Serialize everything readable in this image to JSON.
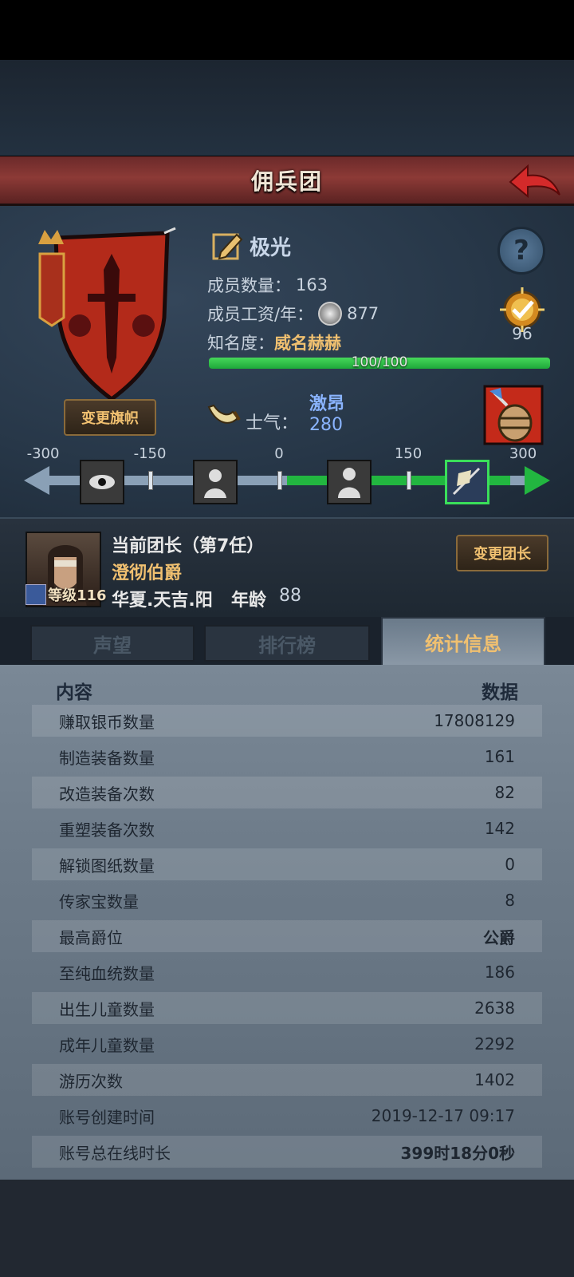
{
  "header": {
    "title": "佣兵团"
  },
  "guild": {
    "name": "极光",
    "members_label": "成员数量：",
    "members": "163",
    "salary_label": "成员工资/年：",
    "salary": "877",
    "fame_label": "知名度：",
    "fame": "威名赫赫",
    "fame_progress_text": "100/100",
    "fame_progress": 1.0,
    "badge_value": "96",
    "change_flag_label": "变更旗帜",
    "morale_label": "士气：",
    "morale_state": "激昂",
    "morale_value": "280"
  },
  "morale_scale": {
    "labels": [
      "-300",
      "-150",
      "0",
      "150",
      "300"
    ],
    "min": -300,
    "max": 300,
    "value": 280
  },
  "leader": {
    "title": "当前团长（第7任）",
    "rank": "澄彻伯爵",
    "level": "等级116",
    "name": "华夏.天吉.阳",
    "age_label": "年龄",
    "age": "88",
    "change_label": "变更团长"
  },
  "tabs": [
    {
      "label": "声望"
    },
    {
      "label": "排行榜"
    },
    {
      "label": "统计信息"
    }
  ],
  "stats": {
    "col_content": "内容",
    "col_data": "数据",
    "rows": [
      {
        "k": "赚取银币数量",
        "v": "17808129"
      },
      {
        "k": "制造装备数量",
        "v": "161"
      },
      {
        "k": "改造装备次数",
        "v": "82"
      },
      {
        "k": "重塑装备次数",
        "v": "142"
      },
      {
        "k": "解锁图纸数量",
        "v": "0"
      },
      {
        "k": "传家宝数量",
        "v": "8"
      },
      {
        "k": "最高爵位",
        "v": "公爵"
      },
      {
        "k": "至纯血统数量",
        "v": "186"
      },
      {
        "k": "出生儿童数量",
        "v": "2638"
      },
      {
        "k": "成年儿童数量",
        "v": "2292"
      },
      {
        "k": "游历次数",
        "v": "1402"
      },
      {
        "k": "账号创建时间",
        "v": "2019-12-17 09:17"
      },
      {
        "k": "账号总在线时长",
        "v": "399时18分0秒"
      }
    ]
  }
}
